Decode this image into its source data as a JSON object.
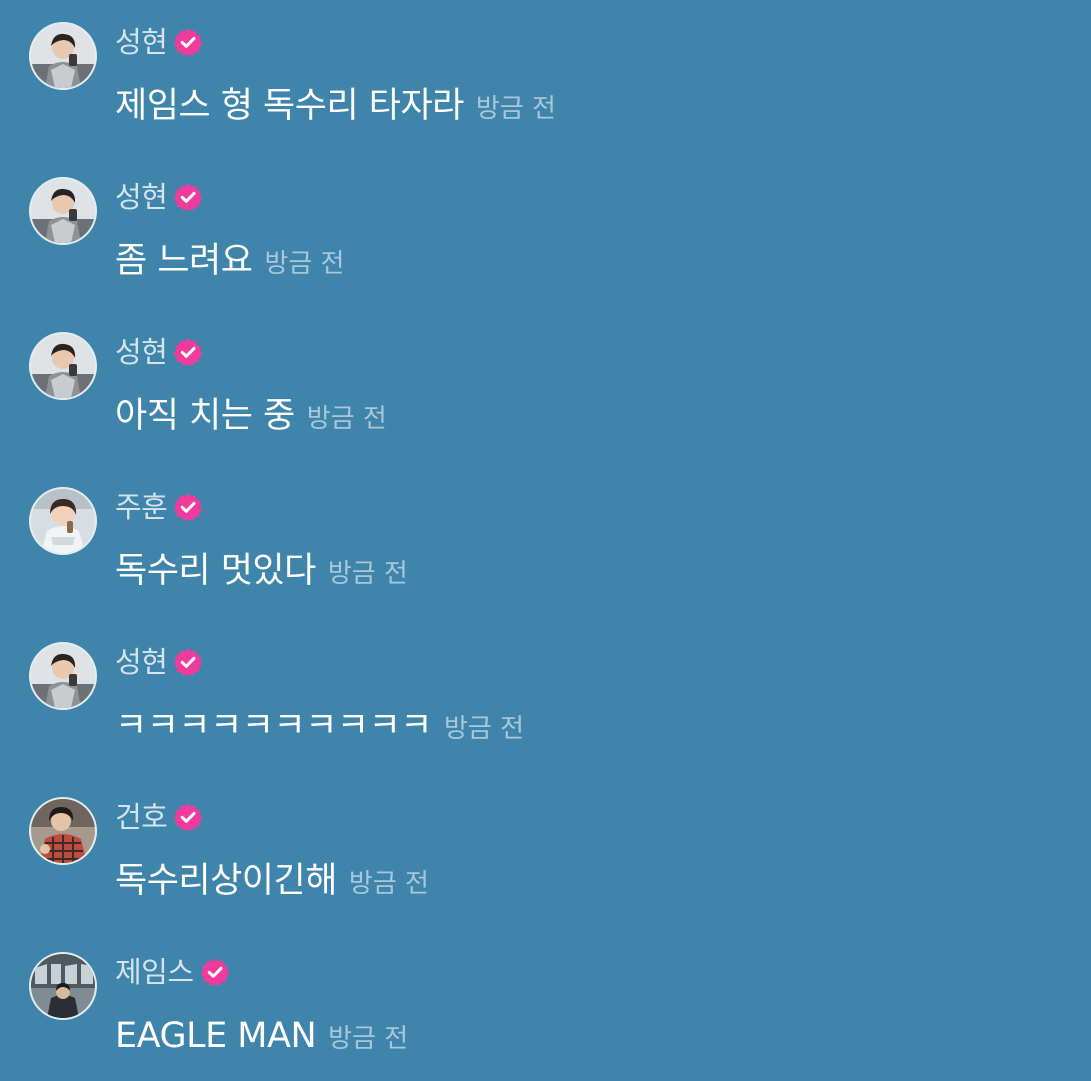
{
  "colors": {
    "background": "#3f84aa",
    "verified_badge": "#ef3c9c",
    "message_text": "#ffffff"
  },
  "messages": [
    {
      "sender": "성현",
      "verified": true,
      "avatar_icon": "avatar-photo",
      "text": "제임스 형 독수리 타자라",
      "time": "방금 전"
    },
    {
      "sender": "성현",
      "verified": true,
      "avatar_icon": "avatar-photo",
      "text": "좀 느려요",
      "time": "방금 전"
    },
    {
      "sender": "성현",
      "verified": true,
      "avatar_icon": "avatar-photo",
      "text": "아직 치는 중",
      "time": "방금 전"
    },
    {
      "sender": "주훈",
      "verified": true,
      "avatar_icon": "avatar-photo",
      "text": "독수리 멋있다",
      "time": "방금 전"
    },
    {
      "sender": "성현",
      "verified": true,
      "avatar_icon": "avatar-photo",
      "text": "ㅋㅋㅋㅋㅋㅋㅋㅋㅋㅋ",
      "time": "방금 전"
    },
    {
      "sender": "건호",
      "verified": true,
      "avatar_icon": "avatar-photo",
      "text": "독수리상이긴해",
      "time": "방금 전"
    },
    {
      "sender": "제임스",
      "verified": true,
      "avatar_icon": "avatar-photo",
      "text": "EAGLE MAN",
      "time": "방금 전"
    }
  ]
}
